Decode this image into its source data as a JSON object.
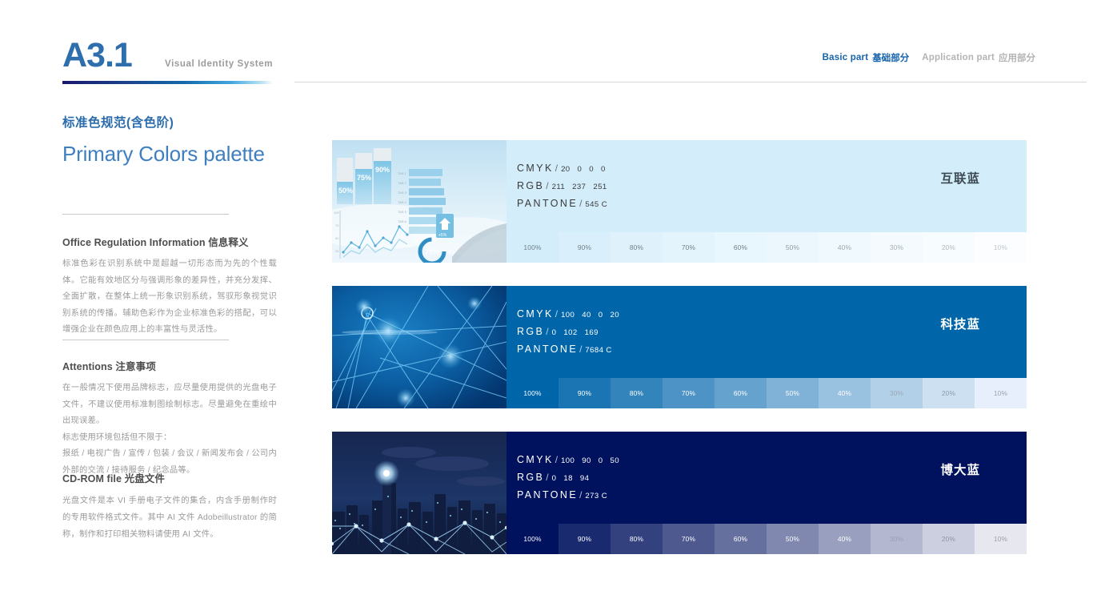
{
  "header": {
    "page_code": "A3.1",
    "subtitle": "Visual Identity System",
    "nav": [
      {
        "en": "Basic part",
        "cn": "基础部分",
        "state": "active"
      },
      {
        "en": "Application part",
        "cn": "应用部分",
        "state": "idle"
      }
    ]
  },
  "left": {
    "section_title_cn": "标准色规范(含色阶)",
    "section_title_en": "Primary Colors palette",
    "blocks": [
      {
        "head_en": "Office Regulation Information",
        "head_cn": "信息释义",
        "body": "标准色彩在识别系统中是超越一切形态而为先的个性载体。它能有效地区分与强调形象的差异性，并充分发挥、全面扩散，在整体上统一形象识别系统，驾驭形象视觉识别系统的传播。辅助色彩作为企业标准色彩的搭配，可以增强企业在颜色应用上的丰富性与灵活性。"
      },
      {
        "head_en": "Attentions",
        "head_cn": "注意事项",
        "body": "在一般情况下使用品牌标志，应尽量使用提供的光盘电子文件，不建议使用标准制图绘制标志。尽量避免在重绘中出现误差。\n标志使用环境包括但不限于：\n报纸 / 电视广告 / 宣传 / 包装 / 会议 / 新闻发布会 / 公司内外部的交流 / 接待服务 / 纪念品等。"
      },
      {
        "head_en": "CD-ROM file",
        "head_cn": "光盘文件",
        "body": "光盘文件是本 VI 手册电子文件的集合，内含手册制作时的专用软件格式文件。其中 AI 文件 Adobeillustrator 的简称，制作和打印相关物料请使用 AI 文件。"
      }
    ]
  },
  "labels": {
    "cmyk": "CMYK",
    "rgb": "RGB",
    "pantone": "PANTONE",
    "slash": "/"
  },
  "tints": [
    "100%",
    "90%",
    "80%",
    "70%",
    "60%",
    "50%",
    "40%",
    "30%",
    "20%",
    "10%"
  ],
  "panels": [
    {
      "name": "互联蓝",
      "cmyk": [
        "20",
        "0",
        "0",
        "0"
      ],
      "rgb": [
        "211",
        "237",
        "251"
      ],
      "pantone": "545 C",
      "hex": "#D3EDFB",
      "thumb": "business-infographic-chart-image",
      "tint_colors": [
        "#d3edfb",
        "#d9effc",
        "#dff2fc",
        "#e3f4fd",
        "#e8f6fd",
        "#ecf7fd",
        "#f0f9fe",
        "#f4fafe",
        "#f7fcfe",
        "#fbfdff"
      ],
      "tint_text_colors": [
        "#6f7f88",
        "#6f7f88",
        "#6f7f88",
        "#6f7f88",
        "#6f7f88",
        "#8e9aa1",
        "#9aa6ac",
        "#a5b0b6",
        "#b0b9be",
        "#bcc4c8"
      ]
    },
    {
      "name": "科技蓝",
      "cmyk": [
        "100",
        "40",
        "0",
        "20"
      ],
      "rgb": [
        "0",
        "102",
        "169"
      ],
      "pantone": "7684 C",
      "hex": "#0066A9",
      "thumb": "abstract-network-lines-image",
      "tint_colors": [
        "#0066a9",
        "#1a75b2",
        "#3384bb",
        "#4d93c5",
        "#66a2ce",
        "#80b2d7",
        "#99c1e0",
        "#b3d0e9",
        "#cce0f2",
        "#e6effb"
      ],
      "tint_text_colors": [
        "#ffffff",
        "#ffffff",
        "#ffffff",
        "#ffffff",
        "#ffffff",
        "#ffffff",
        "#ffffff",
        "#9aa7b3",
        "#8d9aa6",
        "#9aa4ae"
      ]
    },
    {
      "name": "博大蓝",
      "cmyk": [
        "100",
        "90",
        "0",
        "50"
      ],
      "rgb": [
        "0",
        "18",
        "94"
      ],
      "pantone": "273 C",
      "hex": "#00125E",
      "thumb": "night-city-network-image",
      "tint_colors": [
        "#00125e",
        "#1a2a6f",
        "#33417f",
        "#4d598f",
        "#66709f",
        "#8088af",
        "#999fbf",
        "#b3b7cf",
        "#cccfdf",
        "#e6e7ef"
      ],
      "tint_text_colors": [
        "#ffffff",
        "#ffffff",
        "#ffffff",
        "#ffffff",
        "#ffffff",
        "#ffffff",
        "#ffffff",
        "#9ba0b5",
        "#8f94a8",
        "#9ba0ae"
      ]
    }
  ]
}
